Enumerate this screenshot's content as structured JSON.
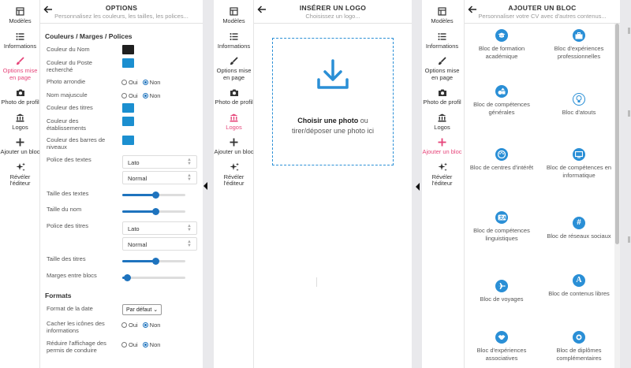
{
  "rail": {
    "items": [
      {
        "label": "Modèles",
        "icon": "layout-icon"
      },
      {
        "label": "Informations",
        "icon": "list-icon"
      },
      {
        "label": "Options mise en page",
        "icon": "brush-icon"
      },
      {
        "label": "Photo de profil",
        "icon": "camera-icon"
      },
      {
        "label": "Logos",
        "icon": "bank-icon"
      },
      {
        "label": "Ajouter un bloc",
        "icon": "plus-icon"
      },
      {
        "label": "Révéler l'éditeur",
        "icon": "sparkles-icon"
      }
    ]
  },
  "colors": {
    "accent": "#e6457a",
    "blue": "#2a8fd6",
    "dark_swatch": "#1f1f1f",
    "blue_swatch": "#1b8fd0"
  },
  "options": {
    "title": "OPTIONS",
    "subtitle": "Personnalisez les couleurs, les tailles, les polices...",
    "section_colors": "Couleurs / Marges / Polices",
    "couleur_nom": "Couleur du Nom",
    "couleur_poste": "Couleur du Poste recherché",
    "photo_arrondie": "Photo arrondie",
    "nom_majuscule": "Nom majuscule",
    "couleur_titres": "Couleur des titres",
    "couleur_etablissements": "Couleur des établissements",
    "couleur_barres": "Couleur des barres de niveaux",
    "police_textes": "Police des textes",
    "police_textes_value": "Lato",
    "police_textes_weight": "Normal",
    "taille_textes": "Taille des textes",
    "taille_nom": "Taille du nom",
    "police_titres": "Police des titres",
    "police_titres_value": "Lato",
    "police_titres_weight": "Normal",
    "taille_titres": "Taille des titres",
    "marges_blocs": "Marges entre blocs",
    "section_formats": "Formats",
    "format_date": "Format de la date",
    "format_date_value": "Par défaut",
    "cacher_icones": "Cacher les icônes des informations",
    "reduire_permis": "Réduire l'affichage des permis de conduire",
    "oui": "Oui",
    "non": "Non",
    "sliders": {
      "taille_textes": 0.52,
      "taille_nom": 0.52,
      "taille_titres": 0.52,
      "marges_blocs": 0.08
    }
  },
  "logo": {
    "title": "INSÉRER UN LOGO",
    "subtitle": "Choisissez un logo...",
    "choose_bold": "Choisir une photo",
    "choose_or": "ou",
    "drag": "tirer/déposer une photo ici"
  },
  "blocks": {
    "title": "AJOUTER UN BLOC",
    "subtitle": "Personnaliser votre CV avec d'autres contenus...",
    "items": [
      {
        "label": "Bloc de formation académique",
        "icon": "graduation-cap-icon"
      },
      {
        "label": "Bloc d'expériences professionnelles",
        "icon": "briefcase-icon"
      },
      {
        "label": "Bloc de compétences générales",
        "icon": "shapes-icon"
      },
      {
        "label": "Bloc d'atouts",
        "icon": "lightbulb-icon"
      },
      {
        "label": "Bloc de centres d'intérêt",
        "icon": "palette-icon"
      },
      {
        "label": "Bloc de compétences en informatique",
        "icon": "monitor-icon"
      },
      {
        "label": "Bloc de compétences linguistiques",
        "icon": "language-icon"
      },
      {
        "label": "Bloc de réseaux sociaux",
        "icon": "hashtag-icon"
      },
      {
        "label": "Bloc de voyages",
        "icon": "plane-icon"
      },
      {
        "label": "Bloc de contenus libres",
        "icon": "letter-a-icon"
      },
      {
        "label": "Bloc d'expériences associatives",
        "icon": "handshake-icon"
      },
      {
        "label": "Bloc de diplômes complémentaires",
        "icon": "certificate-icon"
      }
    ]
  }
}
